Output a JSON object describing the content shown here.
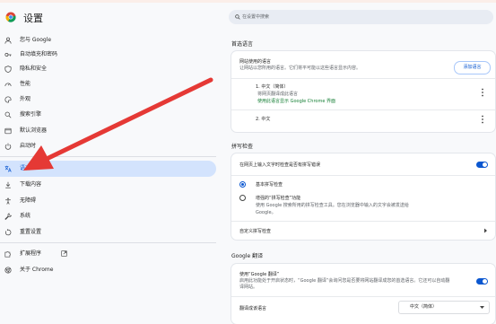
{
  "header": {
    "title": "设置",
    "search_placeholder": "在设置中搜索"
  },
  "sidebar": {
    "items": [
      {
        "label": "您与 Google",
        "icon": "person-icon"
      },
      {
        "label": "自动填充和密码",
        "icon": "key-icon"
      },
      {
        "label": "隐私和安全",
        "icon": "shield-icon"
      },
      {
        "label": "性能",
        "icon": "speedometer-icon"
      },
      {
        "label": "外观",
        "icon": "palette-icon"
      },
      {
        "label": "搜索引擎",
        "icon": "search-icon"
      },
      {
        "label": "默认浏览器",
        "icon": "browser-icon"
      },
      {
        "label": "启动时",
        "icon": "power-icon"
      },
      {
        "label": "语言",
        "icon": "translate-icon",
        "active": true
      },
      {
        "label": "下载内容",
        "icon": "download-icon"
      },
      {
        "label": "无障碍",
        "icon": "accessibility-icon"
      },
      {
        "label": "系统",
        "icon": "wrench-icon"
      },
      {
        "label": "重置设置",
        "icon": "reset-icon"
      },
      {
        "label": "扩展程序",
        "icon": "puzzle-icon"
      },
      {
        "label": "关于 Chrome",
        "icon": "chrome-icon"
      }
    ]
  },
  "preferred_languages": {
    "title": "首选语言",
    "card_title": "网站使用的语言",
    "card_desc": "让网站以您所用的语言。它们将平可能以这些语言显示内容。",
    "add_button": "添加语言",
    "lang1": {
      "name": "1. 中文（简体）",
      "note": "将网页翻译成此语言",
      "display_note": "使用此语言显示 Google Chrome 界面"
    },
    "lang2": {
      "name": "2. 中文"
    }
  },
  "spell_check": {
    "title": "拼写检查",
    "toggle_label": "在网页上输入文字时检查是否有拼写错误",
    "toggle_on": true,
    "option_basic": "基本拼写检查",
    "option_enhanced_title": "增强的“拼写检查”功能",
    "option_enhanced_desc": "使用 Google 搜索所用的拼写检查工具。您在浏览器中输入的文字会被发送给",
    "option_enhanced_desc2": "Google。",
    "selected": "basic",
    "custom_label": "自定义拼写检查"
  },
  "google_translate": {
    "title": "Google 翻译",
    "toggle_label": "使用“Google 翻译”",
    "toggle_desc": "启用此功能处于开启状态时，“Google 翻译”会询问您是否要将网站翻译成您的首选语言。它还可以自动翻",
    "toggle_desc2": "译网站。",
    "toggle_on": true,
    "target_label": "翻译成该语言",
    "target_value": "中文（简体）"
  },
  "colors": {
    "accent": "#0b57d0",
    "active_bg": "#d3e3fd",
    "annotation_arrow": "#e53935"
  }
}
